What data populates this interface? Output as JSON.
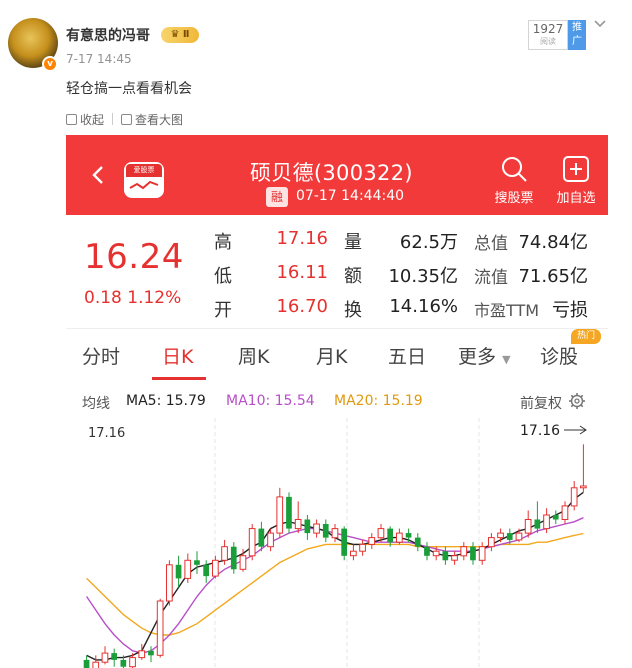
{
  "post": {
    "user_name": "有意思的冯哥",
    "vip_level": "Ⅱ",
    "time": "7-17 14:45",
    "text": "轻仓搞一点看看机会",
    "read_count": "1927",
    "read_label": "阅读",
    "promo_label": "推广",
    "toolbar": {
      "collect": "收起",
      "view_large": "查看大图"
    }
  },
  "app": {
    "logo_text": "爱股票",
    "stock_title": "硕贝德(300322)",
    "margin_badge": "融",
    "datetime": "07-17 14:44:40",
    "search_label": "搜股票",
    "add_label": "加自选"
  },
  "quote": {
    "price": "16.24",
    "change": "0.18  1.12%",
    "fields": {
      "high_label": "高",
      "high": "17.16",
      "low_label": "低",
      "low": "16.11",
      "open_label": "开",
      "open": "16.70",
      "volume_label": "量",
      "volume": "62.5万",
      "amount_label": "额",
      "amount": "10.35亿",
      "turnover_label": "换",
      "turnover": "14.16%",
      "total_cap_label": "总值",
      "total_cap": "74.84亿",
      "float_cap_label": "流值",
      "float_cap": "71.65亿",
      "pe_label": "市盈TTM",
      "pe": "亏损"
    }
  },
  "tabs": [
    "分时",
    "日K",
    "周K",
    "月K",
    "五日",
    "更多",
    "诊股"
  ],
  "active_tab": "日K",
  "hot_badge": "热门",
  "ma_legend": {
    "title": "均线",
    "ma5": "MA5: 15.79",
    "ma10": "MA10: 15.54",
    "ma20": "MA20: 15.19",
    "adjust": "前复权"
  },
  "colors": {
    "brand_red": "#f23a3a",
    "up_red": "#e5312f",
    "down_green": "#1a9e3a",
    "ma5": "#222222",
    "ma10": "#b84fc9",
    "ma20": "#f2a81d"
  },
  "chart_data": {
    "type": "candlestick",
    "y_top_label": "17.16",
    "max_marker": "17.16",
    "ylim": [
      12.0,
      17.3
    ],
    "candles": [
      [
        12.4,
        12.2,
        12.5,
        12.05
      ],
      [
        12.2,
        12.35,
        12.5,
        12.1
      ],
      [
        12.35,
        12.55,
        12.7,
        12.3
      ],
      [
        12.55,
        12.4,
        12.65,
        12.25
      ],
      [
        12.4,
        12.25,
        12.5,
        12.1
      ],
      [
        12.25,
        12.45,
        12.55,
        12.2
      ],
      [
        12.45,
        12.6,
        12.75,
        12.4
      ],
      [
        12.6,
        12.5,
        12.7,
        12.35
      ],
      [
        12.5,
        13.7,
        13.75,
        12.45
      ],
      [
        13.7,
        14.5,
        14.6,
        13.6
      ],
      [
        14.5,
        14.2,
        14.7,
        14.0
      ],
      [
        14.2,
        14.6,
        14.75,
        14.1
      ],
      [
        14.6,
        14.5,
        14.8,
        14.3
      ],
      [
        14.5,
        14.25,
        14.6,
        14.1
      ],
      [
        14.25,
        14.6,
        14.7,
        14.2
      ],
      [
        14.6,
        14.9,
        15.05,
        14.5
      ],
      [
        14.9,
        14.4,
        15.0,
        14.3
      ],
      [
        14.4,
        14.7,
        14.85,
        14.35
      ],
      [
        14.7,
        15.3,
        15.4,
        14.6
      ],
      [
        15.3,
        14.9,
        15.45,
        14.8
      ],
      [
        14.9,
        15.2,
        15.3,
        14.8
      ],
      [
        15.2,
        16.0,
        16.2,
        15.1
      ],
      [
        16.0,
        15.3,
        16.1,
        15.2
      ],
      [
        15.3,
        15.5,
        15.9,
        15.2
      ],
      [
        15.5,
        15.2,
        15.6,
        15.05
      ],
      [
        15.2,
        15.4,
        15.5,
        15.1
      ],
      [
        15.4,
        15.1,
        15.5,
        15.0
      ],
      [
        15.1,
        15.3,
        15.4,
        15.0
      ],
      [
        15.3,
        14.7,
        15.35,
        14.6
      ],
      [
        14.7,
        14.8,
        14.95,
        14.6
      ],
      [
        14.8,
        14.95,
        15.05,
        14.7
      ],
      [
        14.95,
        15.1,
        15.2,
        14.85
      ],
      [
        15.1,
        15.3,
        15.4,
        15.0
      ],
      [
        15.3,
        15.0,
        15.35,
        14.9
      ],
      [
        15.0,
        15.2,
        15.3,
        14.95
      ],
      [
        15.2,
        15.1,
        15.3,
        15.0
      ],
      [
        15.1,
        14.9,
        15.2,
        14.8
      ],
      [
        14.9,
        14.7,
        15.0,
        14.6
      ],
      [
        14.7,
        14.8,
        14.9,
        14.6
      ],
      [
        14.8,
        14.6,
        14.9,
        14.5
      ],
      [
        14.6,
        14.7,
        14.8,
        14.5
      ],
      [
        14.7,
        14.9,
        15.0,
        14.6
      ],
      [
        14.9,
        14.6,
        15.0,
        14.5
      ],
      [
        14.6,
        14.9,
        15.0,
        14.5
      ],
      [
        14.9,
        15.1,
        15.2,
        14.8
      ],
      [
        15.1,
        15.2,
        15.3,
        15.0
      ],
      [
        15.2,
        15.05,
        15.3,
        14.95
      ],
      [
        15.05,
        15.2,
        15.3,
        15.0
      ],
      [
        15.2,
        15.5,
        15.7,
        15.1
      ],
      [
        15.5,
        15.3,
        15.9,
        15.2
      ],
      [
        15.3,
        15.6,
        15.75,
        15.2
      ],
      [
        15.6,
        15.5,
        15.7,
        15.4
      ],
      [
        15.5,
        15.8,
        15.9,
        15.4
      ],
      [
        15.8,
        16.2,
        16.35,
        15.7
      ],
      [
        16.2,
        16.24,
        17.16,
        16.11
      ]
    ],
    "ma5": [
      12.5,
      12.4,
      12.4,
      12.45,
      12.45,
      12.5,
      12.6,
      13.0,
      13.4,
      13.7,
      14.0,
      14.3,
      14.45,
      14.5,
      14.55,
      14.6,
      14.65,
      14.75,
      14.9,
      15.0,
      15.3,
      15.4,
      15.45,
      15.4,
      15.35,
      15.3,
      15.25,
      15.1,
      15.0,
      14.95,
      14.95,
      15.0,
      15.05,
      15.1,
      15.1,
      15.05,
      14.95,
      14.85,
      14.75,
      14.7,
      14.7,
      14.75,
      14.8,
      14.85,
      14.95,
      15.05,
      15.15,
      15.25,
      15.3,
      15.4,
      15.5,
      15.6,
      15.7,
      15.95,
      16.1
    ],
    "ma10": [
      13.8,
      13.5,
      13.2,
      12.95,
      12.75,
      12.6,
      12.55,
      12.6,
      12.75,
      12.95,
      13.2,
      13.5,
      13.8,
      14.05,
      14.25,
      14.4,
      14.5,
      14.6,
      14.7,
      14.85,
      15.0,
      15.1,
      15.2,
      15.25,
      15.3,
      15.3,
      15.25,
      15.2,
      15.15,
      15.1,
      15.05,
      15.0,
      15.0,
      15.0,
      15.0,
      15.0,
      14.95,
      14.9,
      14.85,
      14.8,
      14.8,
      14.8,
      14.8,
      14.85,
      14.9,
      14.95,
      15.0,
      15.05,
      15.15,
      15.25,
      15.3,
      15.35,
      15.4,
      15.45,
      15.54
    ],
    "ma20": [
      14.2,
      14.0,
      13.8,
      13.6,
      13.4,
      13.25,
      13.1,
      13.0,
      12.95,
      12.95,
      13.0,
      13.1,
      13.2,
      13.35,
      13.5,
      13.65,
      13.8,
      13.95,
      14.1,
      14.25,
      14.4,
      14.55,
      14.65,
      14.75,
      14.85,
      14.9,
      14.95,
      14.95,
      14.95,
      14.95,
      14.95,
      14.95,
      14.95,
      14.95,
      14.95,
      14.95,
      14.9,
      14.9,
      14.9,
      14.9,
      14.9,
      14.9,
      14.9,
      14.9,
      14.9,
      14.95,
      14.95,
      14.95,
      14.95,
      15.0,
      15.0,
      15.05,
      15.1,
      15.15,
      15.19
    ]
  }
}
